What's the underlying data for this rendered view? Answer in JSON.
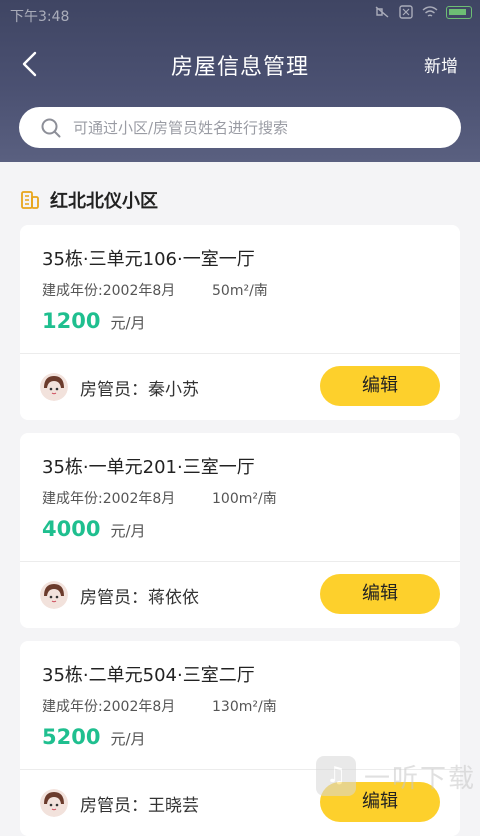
{
  "status_bar": {
    "time": "下午3:48"
  },
  "nav": {
    "title": "房屋信息管理",
    "add_label": "新增"
  },
  "search": {
    "placeholder": "可通过小区/房管员姓名进行搜索"
  },
  "community": {
    "name": "红北北仪小区"
  },
  "listings": [
    {
      "name": "35栋·三单元106·一室一厅",
      "built_year": "建成年份:2002年8月",
      "area": "50m²/南",
      "price": "1200",
      "price_unit": "元/月",
      "manager": "房管员：秦小苏",
      "edit_label": "编辑"
    },
    {
      "name": "35栋·一单元201·三室一厅",
      "built_year": "建成年份:2002年8月",
      "area": "100m²/南",
      "price": "4000",
      "price_unit": "元/月",
      "manager": "房管员：蒋依依",
      "edit_label": "编辑"
    },
    {
      "name": "35栋·二单元504·三室二厅",
      "built_year": "建成年份:2002年8月",
      "area": "130m²/南",
      "price": "5200",
      "price_unit": "元/月",
      "manager": "房管员：王晓芸",
      "edit_label": "编辑"
    }
  ],
  "colors": {
    "header": "#474d6c",
    "price": "#1fbf8f",
    "button": "#fdd02c"
  },
  "icons": {
    "back": "chevron-left-icon",
    "search": "search-icon",
    "building": "building-icon"
  },
  "watermark": {
    "text": "一听下载"
  }
}
